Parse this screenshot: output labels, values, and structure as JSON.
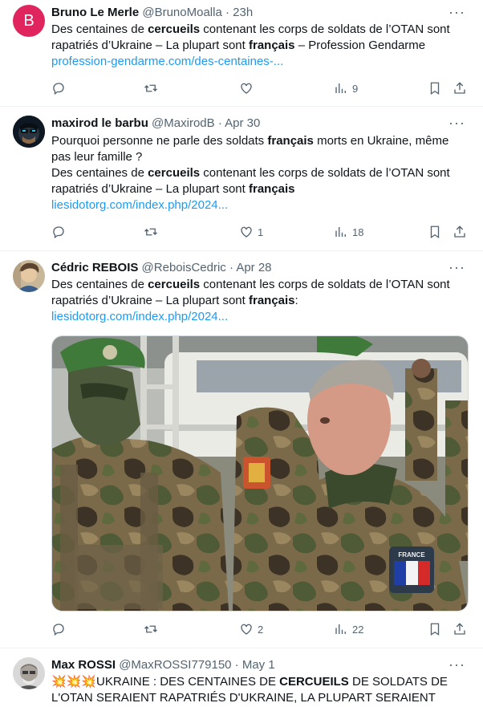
{
  "tweets": [
    {
      "name": "Bruno Le Merle",
      "handle": "@BrunoMoalla",
      "time": "· 23h",
      "avatar_letter": "B",
      "line1_a": "Des centaines de ",
      "line1_b": "cercueils",
      "line1_c": " contenant les corps de soldats de l’OTAN sont",
      "line2_a": "rapatriés d’Ukraine – La plupart sont ",
      "line2_b": "français",
      "line2_c": " – Profession Gendarme",
      "link": "profession-gendarme.com/des-centaines-...",
      "views": "9"
    },
    {
      "name": "maxirod le barbu",
      "handle": "@MaxirodB",
      "time": "· Apr 30",
      "line1_a": "Pourquoi personne ne parle des soldats ",
      "line1_b": "français",
      "line1_c": " morts en Ukraine, même",
      "line2": "pas leur famille ?",
      "line3_a": "Des centaines de ",
      "line3_b": "cercueils",
      "line3_c": " contenant les corps de soldats de l’OTAN sont",
      "line4_a": "rapatriés d’Ukraine – La plupart sont ",
      "line4_b": "français",
      "link": "liesidotorg.com/index.php/2024...",
      "likes": "1",
      "views": "18"
    },
    {
      "name": "Cédric REBOIS",
      "handle": "@ReboisCedric",
      "time": "· Apr 28",
      "line1_a": "Des centaines de ",
      "line1_b": "cercueils",
      "line1_c": " contenant les corps de soldats de l’OTAN sont",
      "line2_a": "rapatriés d’Ukraine – La plupart sont ",
      "line2_b": "français",
      "line2_c": ":",
      "link": "liesidotorg.com/index.php/2024...",
      "patch_text": "FRANCE",
      "likes": "2",
      "views": "22"
    },
    {
      "name": "Max ROSSI",
      "handle": "@MaxROSSI779150",
      "time": "· May 1",
      "emoji": "💥💥💥",
      "line1_a": "UKRAINE : DES CENTAINES DE ",
      "line1_b": "CERCUEILS",
      "line1_c": " DE SOLDATS DE",
      "line2": "L'OTAN SERAIENT RAPATRIÉS D'UKRAINE, LA PLUPART SERAIENT"
    }
  ],
  "icons": {
    "reply": "reply-icon",
    "retweet": "retweet-icon",
    "like": "like-icon",
    "views": "views-icon",
    "bookmark": "bookmark-icon",
    "share": "share-icon"
  },
  "colors": {
    "link": "#1d9bf0",
    "avatar_b": "#e0245e",
    "secondary_text": "#536471"
  }
}
